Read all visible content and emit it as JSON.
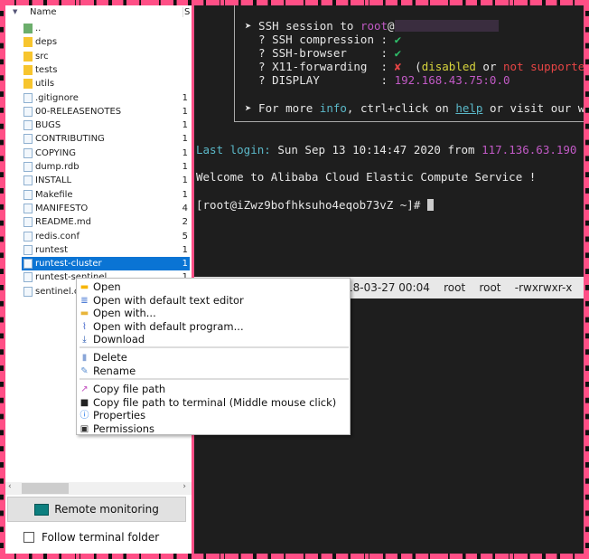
{
  "file_panel": {
    "header": {
      "name_col": "Name",
      "size_col": "S"
    },
    "rows": [
      {
        "name": "..",
        "size": "",
        "type": "up"
      },
      {
        "name": "deps",
        "size": "",
        "type": "folder"
      },
      {
        "name": "src",
        "size": "",
        "type": "folder"
      },
      {
        "name": "tests",
        "size": "",
        "type": "folder"
      },
      {
        "name": "utils",
        "size": "",
        "type": "folder"
      },
      {
        "name": ".gitignore",
        "size": "1",
        "type": "file"
      },
      {
        "name": "00-RELEASENOTES",
        "size": "1",
        "type": "file"
      },
      {
        "name": "BUGS",
        "size": "1",
        "type": "file"
      },
      {
        "name": "CONTRIBUTING",
        "size": "1",
        "type": "file"
      },
      {
        "name": "COPYING",
        "size": "1",
        "type": "file"
      },
      {
        "name": "dump.rdb",
        "size": "1",
        "type": "file"
      },
      {
        "name": "INSTALL",
        "size": "1",
        "type": "file"
      },
      {
        "name": "Makefile",
        "size": "1",
        "type": "file"
      },
      {
        "name": "MANIFESTO",
        "size": "4",
        "type": "file"
      },
      {
        "name": "README.md",
        "size": "2",
        "type": "file"
      },
      {
        "name": "redis.conf",
        "size": "5",
        "type": "file"
      },
      {
        "name": "runtest",
        "size": "1",
        "type": "file"
      },
      {
        "name": "runtest-cluster",
        "size": "1",
        "type": "file",
        "selected": true
      },
      {
        "name": "runtest-sentinel",
        "size": "1",
        "type": "file"
      },
      {
        "name": "sentinel.conf",
        "size": "",
        "type": "file"
      }
    ],
    "scroll_left": "‹",
    "scroll_right": "›",
    "remote_monitoring_label": "Remote monitoring",
    "follow_terminal_label": "Follow terminal folder",
    "follow_terminal_checked": false
  },
  "terminal": {
    "l1a": "➤ SSH session to ",
    "l1b": "root",
    "l1c": "@",
    "l2a": "  ? SSH compression : ",
    "l2b": "✔",
    "l3a": "  ? SSH-browser     : ",
    "l3b": "✔",
    "l4a": "  ? X11-forwarding  : ",
    "l4b": "✘",
    "l4c": "  (",
    "l4d": "disabled",
    "l4e": " or ",
    "l4f": "not supported",
    "l5a": "  ? DISPLAY         : ",
    "l5b": "192.168.43.75:0.0",
    "l6a": "➤ For more ",
    "l6b": "info",
    "l6c": ", ctrl+click on ",
    "l6d": "help",
    "l6e": " or visit our website",
    "login_a": "Last login:",
    "login_b": " Sun Sep 13 10:14:47 2020 from ",
    "login_c": "117.136.63.190",
    "welcome": "Welcome to Alibaba Cloud Elastic Compute Service !",
    "prompt": "[root@iZwz9bofhksuho4eqob73vZ ~]# "
  },
  "file_tooltip": "18-03-27 00:04    root    root    -rwxrwxr-x",
  "context_menu": {
    "items": [
      {
        "label": "Open",
        "icon": "folder-icon"
      },
      {
        "label": "Open with default text editor",
        "icon": "text-editor-icon"
      },
      {
        "label": "Open with...",
        "icon": "open-with-icon"
      },
      {
        "label": "Open with default program...",
        "icon": "paperclip-icon"
      },
      {
        "label": "Download",
        "icon": "download-icon"
      },
      {
        "label": "Delete",
        "icon": "delete-icon"
      },
      {
        "label": "Rename",
        "icon": "rename-icon"
      },
      {
        "label": "Copy file path",
        "icon": "copy-path-icon"
      },
      {
        "label": "Copy file path to terminal (Middle mouse click)",
        "icon": "terminal-icon"
      },
      {
        "label": "Properties",
        "icon": "info-icon"
      },
      {
        "label": "Permissions",
        "icon": "permissions-icon"
      }
    ]
  },
  "colors": {
    "accent": "#0a74d4",
    "terminal_bg": "#1e1e1e",
    "border": "#ff4f86"
  }
}
